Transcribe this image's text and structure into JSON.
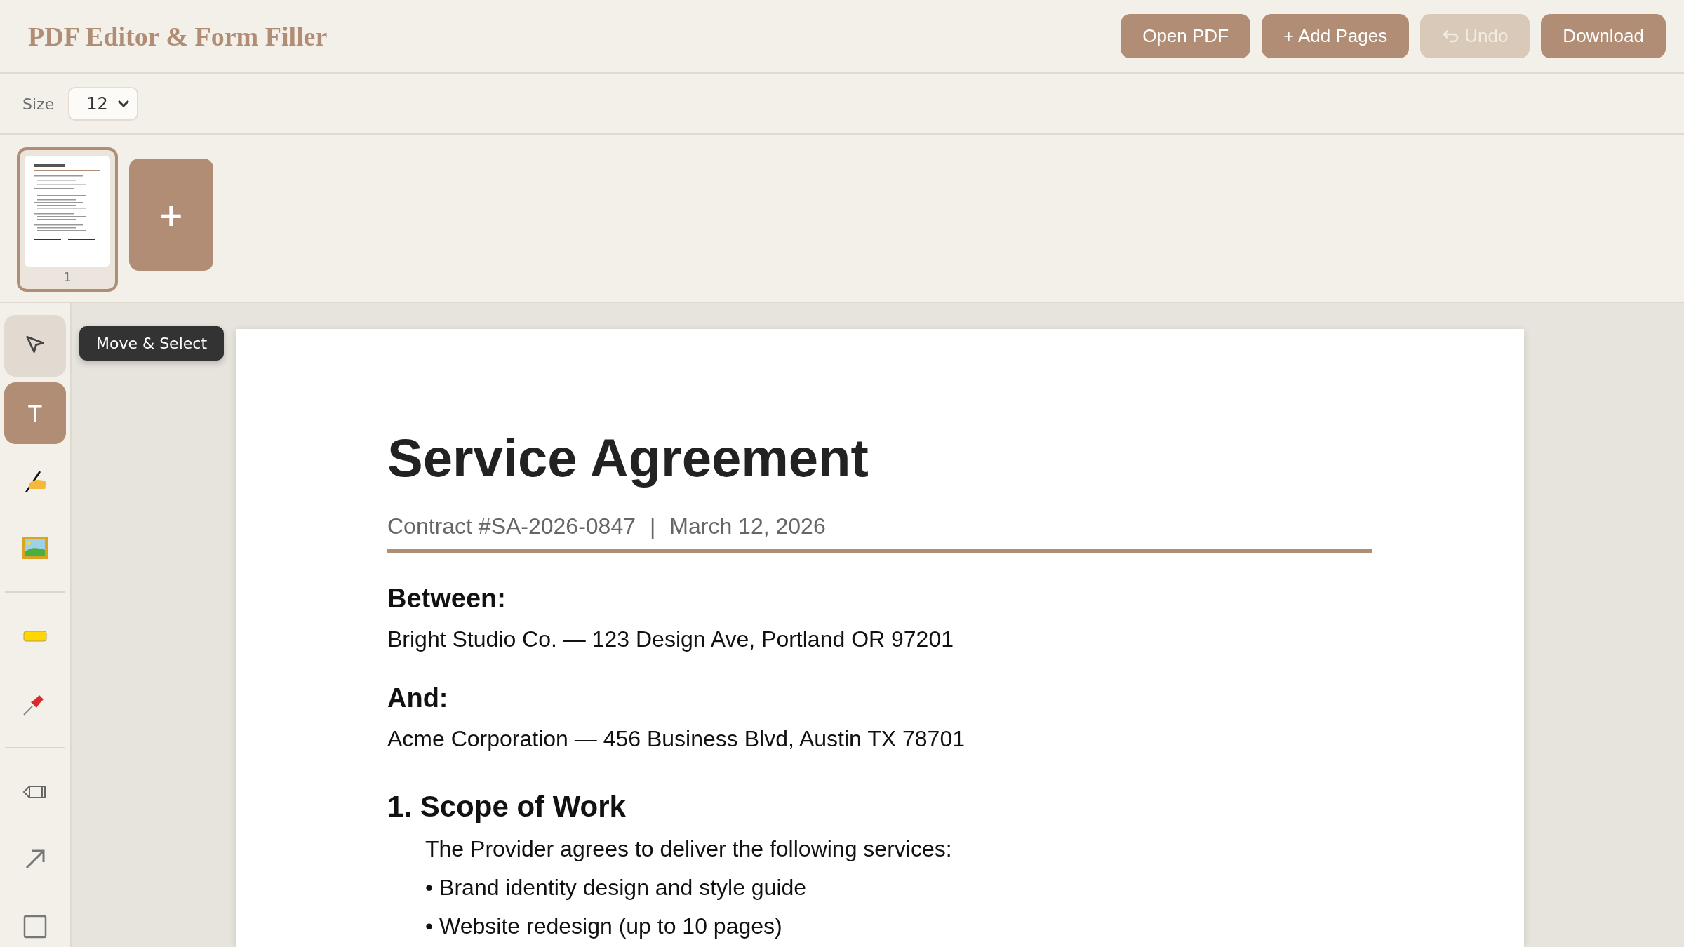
{
  "header": {
    "title": "PDF Editor & Form Filler",
    "buttons": [
      {
        "label": "Open PDF",
        "kind": "plain",
        "disabled": false
      },
      {
        "label": "+ Add Pages",
        "kind": "plain",
        "disabled": false
      },
      {
        "label": "Undo",
        "kind": "undo",
        "disabled": true
      },
      {
        "label": "Download",
        "kind": "plain",
        "disabled": false
      }
    ]
  },
  "options_bar": {
    "size_label": "Size",
    "size_value": "12"
  },
  "pages": {
    "thumbnails": [
      {
        "number": "1",
        "selected": true
      }
    ],
    "add_label": "+"
  },
  "toolbar": {
    "groups": [
      [
        {
          "kind": "select",
          "hovered": true,
          "selected": false
        },
        {
          "kind": "text",
          "label": "T",
          "hovered": false,
          "selected": true
        },
        {
          "kind": "signature",
          "hovered": false,
          "selected": false
        },
        {
          "kind": "image",
          "hovered": false,
          "selected": false
        }
      ],
      [
        {
          "kind": "highlight",
          "hovered": false,
          "selected": false
        },
        {
          "kind": "pin",
          "hovered": false,
          "selected": false
        }
      ],
      [
        {
          "kind": "pencil",
          "hovered": false,
          "selected": false
        },
        {
          "kind": "arrow",
          "hovered": false,
          "selected": false
        },
        {
          "kind": "rectangle",
          "hovered": false,
          "selected": false
        }
      ]
    ],
    "tooltip": "Move & Select"
  },
  "document": {
    "title": "Service Agreement",
    "contract_number": "Contract #SA-2026-0847",
    "separator": "|",
    "date": "March 12, 2026",
    "blocks": [
      {
        "kind": "heading",
        "text": "Between:"
      },
      {
        "kind": "text",
        "text": "Bright Studio Co. — 123 Design Ave, Portland OR 97201"
      },
      {
        "kind": "heading",
        "text": "And:"
      },
      {
        "kind": "text",
        "text": "Acme Corporation — 456 Business Blvd, Austin TX 78701"
      },
      {
        "kind": "section",
        "text": "1. Scope of Work"
      },
      {
        "kind": "indented",
        "text": "The Provider agrees to deliver the following services:"
      },
      {
        "kind": "bullet",
        "text": "• Brand identity design and style guide"
      },
      {
        "kind": "bullet",
        "text": "• Website redesign (up to 10 pages)"
      }
    ]
  }
}
